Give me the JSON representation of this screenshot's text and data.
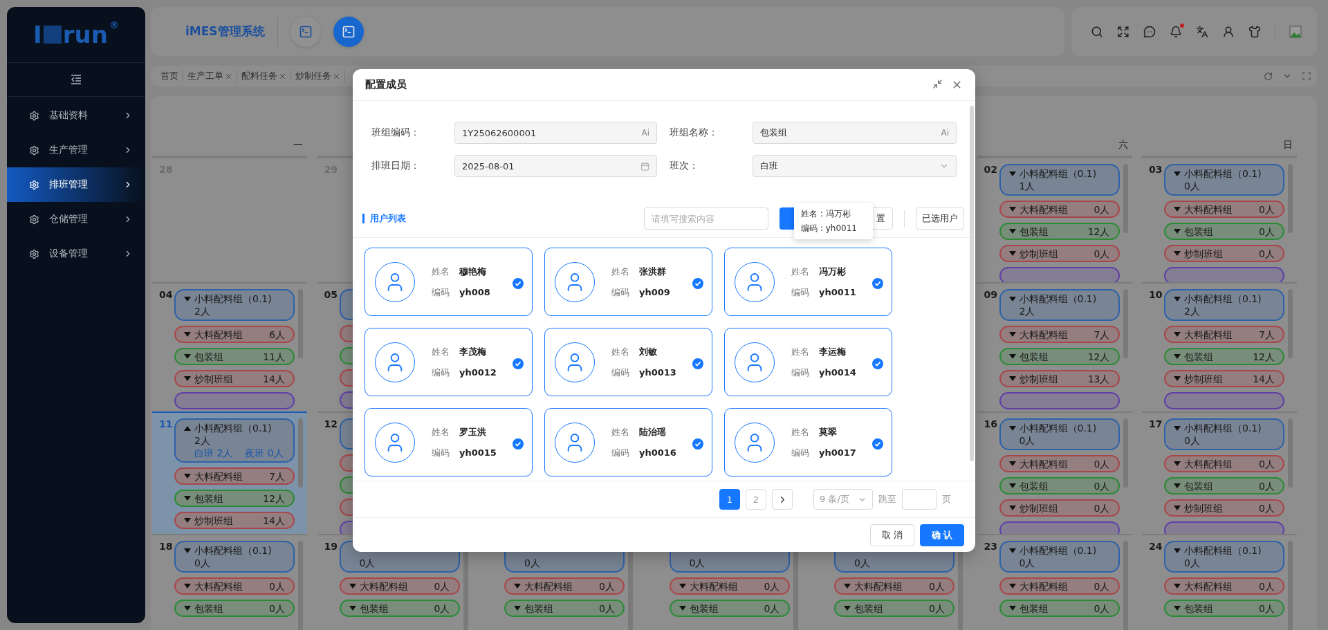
{
  "sidebar": {
    "logo": {
      "lead": "I",
      "text": "run",
      "mark": "®"
    },
    "items": [
      {
        "label": "基础资料",
        "selected": false
      },
      {
        "label": "生产管理",
        "selected": false
      },
      {
        "label": "排班管理",
        "selected": true
      },
      {
        "label": "仓储管理",
        "selected": false
      },
      {
        "label": "设备管理",
        "selected": false
      }
    ]
  },
  "header": {
    "title": "iMES管理系统",
    "quick_buttons": [
      {
        "selected": false
      },
      {
        "selected": true
      }
    ],
    "bell_badge": true
  },
  "tabs": [
    {
      "label": "首页",
      "closable": false
    },
    {
      "label": "生产工单",
      "closable": true
    },
    {
      "label": "配料任务",
      "closable": true
    },
    {
      "label": "炒制任务",
      "closable": true
    }
  ],
  "calendar": {
    "weekdays": [
      {
        "label": "一"
      },
      {
        "label": "六"
      },
      {
        "label": "日"
      }
    ],
    "weeks": [
      [
        {
          "date": "28",
          "outside_month": true,
          "selected": false
        },
        {
          "date": "29",
          "outside_month": true,
          "selected": false
        },
        {
          "date": "02",
          "outside_month": false,
          "selected": false,
          "groups": [
            {
              "name": "小料配料组（0.1)",
              "count": "1人",
              "color": "#2e62a8",
              "expanded": false
            },
            {
              "name": "大料配料组",
              "count": "0人",
              "color": "#a8474a",
              "expanded": false
            },
            {
              "name": "包装组",
              "count": "12人",
              "color": "#2b8a35",
              "expanded": false
            },
            {
              "name": "炒制班组",
              "count": "0人",
              "color": "#a8474a",
              "expanded": false
            },
            {
              "color": "#5f3fa6"
            }
          ]
        },
        {
          "date": "03",
          "outside_month": false,
          "selected": false,
          "groups": [
            {
              "name": "小料配料组（0.1)",
              "count": "0人",
              "color": "#2e62a8",
              "expanded": false
            },
            {
              "name": "大料配料组",
              "count": "0人",
              "color": "#a8474a",
              "expanded": false
            },
            {
              "name": "包装组",
              "count": "0人",
              "color": "#2b8a35",
              "expanded": false
            },
            {
              "name": "炒制班组",
              "count": "0人",
              "color": "#a8474a",
              "expanded": false
            },
            {
              "color": "#5f3fa6"
            }
          ]
        }
      ],
      [
        {
          "date": "04",
          "outside_month": false,
          "selected": false,
          "groups": [
            {
              "name": "小料配料组（0.1)",
              "count": "2人",
              "color": "#2e62a8",
              "expanded": false
            },
            {
              "name": "大料配料组",
              "count": "6人",
              "color": "#a8474a",
              "expanded": false
            },
            {
              "name": "包装组",
              "count": "11人",
              "color": "#2b8a35",
              "expanded": false
            },
            {
              "name": "炒制班组",
              "count": "14人",
              "color": "#a8474a",
              "expanded": false
            },
            {
              "color": "#5f3fa6"
            }
          ]
        },
        {
          "date": "05",
          "outside_month": false,
          "selected": false,
          "groups": [
            {
              "color": "#2e62a8"
            },
            {
              "color": "#a8474a"
            },
            {
              "color": "#2b8a35"
            },
            {
              "color": "#a8474a"
            },
            {
              "color": "#5f3fa6"
            }
          ]
        },
        {
          "date": "09",
          "outside_month": false,
          "selected": false,
          "groups": [
            {
              "name": "小料配料组（0.1)",
              "count": "2人",
              "color": "#2e62a8",
              "expanded": false
            },
            {
              "name": "大料配料组",
              "count": "7人",
              "color": "#a8474a",
              "expanded": false
            },
            {
              "name": "包装组",
              "count": "12人",
              "color": "#2b8a35",
              "expanded": false
            },
            {
              "name": "炒制班组",
              "count": "13人",
              "color": "#a8474a",
              "expanded": false
            },
            {
              "color": "#5f3fa6"
            }
          ]
        },
        {
          "date": "10",
          "outside_month": false,
          "selected": false,
          "groups": [
            {
              "name": "小料配料组（0.1)",
              "count": "2人",
              "color": "#2e62a8",
              "expanded": false
            },
            {
              "name": "大料配料组",
              "count": "7人",
              "color": "#a8474a",
              "expanded": false
            },
            {
              "name": "包装组",
              "count": "12人",
              "color": "#2b8a35",
              "expanded": false
            },
            {
              "name": "炒制班组",
              "count": "14人",
              "color": "#a8474a",
              "expanded": false
            },
            {
              "color": "#5f3fa6"
            }
          ]
        }
      ],
      [
        {
          "date": "11",
          "outside_month": false,
          "selected": true,
          "groups": [
            {
              "name": "小料配料组（0.1)",
              "count": "2人",
              "color": "#2e62a8",
              "expanded": true,
              "shifts": [
                "白班 2人",
                "夜班 0人"
              ]
            },
            {
              "name": "大料配料组",
              "count": "7人",
              "color": "#a8474a",
              "expanded": false
            },
            {
              "name": "包装组",
              "count": "12人",
              "color": "#2b8a35",
              "expanded": false
            },
            {
              "name": "炒制班组",
              "count": "14人",
              "color": "#a8474a",
              "expanded": false
            }
          ]
        },
        {
          "date": "12",
          "outside_month": false,
          "selected": false,
          "groups": [
            {
              "color": "#2e62a8"
            },
            {
              "color": "#a8474a"
            },
            {
              "color": "#2b8a35"
            },
            {
              "color": "#a8474a"
            },
            {
              "color": "#5f3fa6"
            }
          ]
        },
        {
          "date": "16",
          "outside_month": false,
          "selected": false,
          "groups": [
            {
              "name": "小料配料组（0.1)",
              "count": "0人",
              "color": "#2e62a8",
              "expanded": false
            },
            {
              "name": "大料配料组",
              "count": "0人",
              "color": "#a8474a",
              "expanded": false
            },
            {
              "name": "包装组",
              "count": "0人",
              "color": "#2b8a35",
              "expanded": false
            },
            {
              "name": "炒制班组",
              "count": "0人",
              "color": "#a8474a",
              "expanded": false
            },
            {
              "color": "#5f3fa6"
            }
          ]
        },
        {
          "date": "17",
          "outside_month": false,
          "selected": false,
          "groups": [
            {
              "name": "小料配料组（0.1)",
              "count": "0人",
              "color": "#2e62a8",
              "expanded": false
            },
            {
              "name": "大料配料组",
              "count": "0人",
              "color": "#a8474a",
              "expanded": false
            },
            {
              "name": "包装组",
              "count": "0人",
              "color": "#2b8a35",
              "expanded": false
            },
            {
              "name": "炒制班组",
              "count": "0人",
              "color": "#a8474a",
              "expanded": false
            },
            {
              "color": "#5f3fa6"
            }
          ]
        }
      ],
      [
        {
          "date": "18",
          "outside_month": false,
          "selected": false,
          "groups": [
            {
              "name": "小料配料组（0.1)",
              "count": "0人",
              "color": "#2e62a8",
              "expanded": false
            },
            {
              "name": "大料配料组",
              "count": "0人",
              "color": "#a8474a",
              "expanded": false
            },
            {
              "name": "包装组",
              "count": "0人",
              "color": "#2b8a35",
              "expanded": false
            }
          ]
        },
        {
          "date": "19",
          "outside_month": false,
          "selected": false,
          "groups": [
            {
              "count": "0人",
              "color": "#2e62a8"
            },
            {
              "name": "大料配料组",
              "count": "0人",
              "color": "#a8474a",
              "expanded": false
            },
            {
              "name": "包装组",
              "count": "0人",
              "color": "#2b8a35",
              "expanded": false
            }
          ]
        },
        {
          "selected": false,
          "groups": [
            {
              "count": "0人",
              "color": "#2e62a8"
            },
            {
              "name": "大料配料组",
              "count": "0人",
              "color": "#a8474a",
              "expanded": false
            },
            {
              "name": "包装组",
              "count": "0人",
              "color": "#2b8a35",
              "expanded": false
            }
          ]
        },
        {
          "selected": false,
          "groups": [
            {
              "count": "0人",
              "color": "#2e62a8"
            },
            {
              "name": "大料配料组",
              "count": "0人",
              "color": "#a8474a",
              "expanded": false
            },
            {
              "name": "包装组",
              "count": "0人",
              "color": "#2b8a35",
              "expanded": false
            }
          ]
        },
        {
          "selected": false,
          "groups": [
            {
              "count": "0人",
              "color": "#2e62a8"
            },
            {
              "name": "大料配料组",
              "count": "0人",
              "color": "#a8474a",
              "expanded": false
            },
            {
              "name": "包装组",
              "count": "0人",
              "color": "#2b8a35",
              "expanded": false
            }
          ]
        },
        {
          "date": "23",
          "outside_month": false,
          "selected": false,
          "groups": [
            {
              "name": "小料配料组（0.1)",
              "count": "0人",
              "color": "#2e62a8",
              "expanded": false
            },
            {
              "name": "大料配料组",
              "count": "0人",
              "color": "#a8474a",
              "expanded": false
            },
            {
              "name": "包装组",
              "count": "0人",
              "color": "#2b8a35",
              "expanded": false
            }
          ]
        },
        {
          "date": "24",
          "outside_month": false,
          "selected": false,
          "groups": [
            {
              "name": "小料配料组（0.1)",
              "count": "0人",
              "color": "#2e62a8",
              "expanded": false
            },
            {
              "name": "大料配料组",
              "count": "0人",
              "color": "#a8474a",
              "expanded": false
            },
            {
              "name": "包装组",
              "count": "0人",
              "color": "#2b8a35",
              "expanded": false
            }
          ]
        }
      ]
    ]
  },
  "dialog": {
    "title": "配置成员",
    "fields": [
      {
        "label": "班组编码：",
        "value": "1Y25062600001",
        "kind": "ai",
        "suffix": "Ai"
      },
      {
        "label": "班组名称：",
        "value": "包装组",
        "kind": "ai",
        "suffix": "Ai"
      },
      {
        "label": "排班日期：",
        "value": "2025-08-01",
        "kind": "date"
      },
      {
        "label": "班次：",
        "value": "白班",
        "kind": "select"
      }
    ],
    "section_title": "用户列表",
    "search": {
      "placeholder": "请填写搜索内容"
    },
    "reset_label": "置",
    "selected_users_button": "已选用户",
    "tooltip": [
      "姓名 : 冯万彬",
      "编码 : yh0011"
    ],
    "users": [
      {
        "name_label": "姓名",
        "name": "穆艳梅",
        "code_label": "编码",
        "code": "yh008",
        "selected": true
      },
      {
        "name_label": "姓名",
        "name": "张洪群",
        "code_label": "编码",
        "code": "yh009",
        "selected": true
      },
      {
        "name_label": "姓名",
        "name": "冯万彬",
        "code_label": "编码",
        "code": "yh0011",
        "selected": true
      },
      {
        "name_label": "姓名",
        "name": "李茂梅",
        "code_label": "编码",
        "code": "yh0012",
        "selected": true
      },
      {
        "name_label": "姓名",
        "name": "刘敏",
        "code_label": "编码",
        "code": "yh0013",
        "selected": true
      },
      {
        "name_label": "姓名",
        "name": "李运梅",
        "code_label": "编码",
        "code": "yh0014",
        "selected": true
      },
      {
        "name_label": "姓名",
        "name": "罗玉洪",
        "code_label": "编码",
        "code": "yh0015",
        "selected": true
      },
      {
        "name_label": "姓名",
        "name": "陆治瑶",
        "code_label": "编码",
        "code": "yh0016",
        "selected": true
      },
      {
        "name_label": "姓名",
        "name": "莫翠",
        "code_label": "编码",
        "code": "yh0017",
        "selected": true
      }
    ],
    "pagination": {
      "pages": [
        {
          "label": "1",
          "selected": true
        },
        {
          "label": "2",
          "selected": false
        }
      ],
      "page_size": "9 条/页",
      "jump_label": "跳至",
      "page_unit": "页"
    },
    "cancel": "取 消",
    "confirm": "确 认"
  }
}
